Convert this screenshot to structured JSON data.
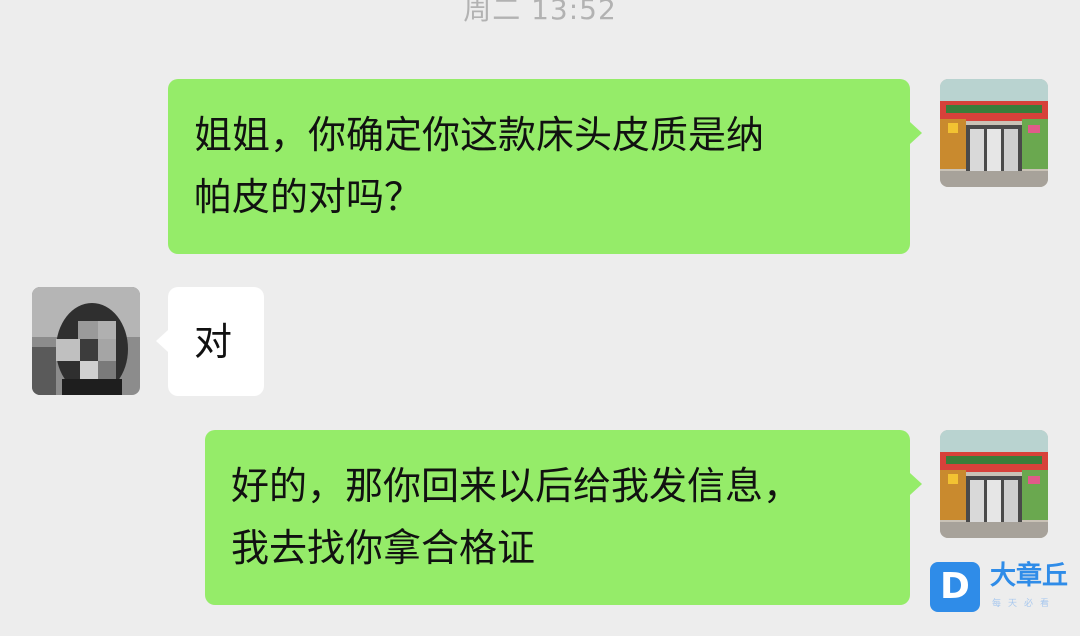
{
  "chat": {
    "timestamp": "周二 13:52",
    "messages": [
      {
        "direction": "outgoing",
        "sender": "me",
        "lines": [
          "姐姐，你确定你这款床头皮质是纳",
          "帕皮的对吗？"
        ]
      },
      {
        "direction": "incoming",
        "sender": "contact",
        "lines": [
          "对"
        ]
      },
      {
        "direction": "outgoing",
        "sender": "me",
        "lines": [
          "好的，那你回来以后给我发信息，",
          "我去找你拿合格证"
        ]
      }
    ]
  },
  "watermark": {
    "logo_letter": "D",
    "title": "大章丘",
    "subtitle": "每天必看"
  },
  "colors": {
    "background": "#ededed",
    "outgoing_bubble": "#95ec69",
    "incoming_bubble": "#ffffff",
    "timestamp_text": "#b2b2b2",
    "watermark_blue": "#2f8ce8"
  }
}
